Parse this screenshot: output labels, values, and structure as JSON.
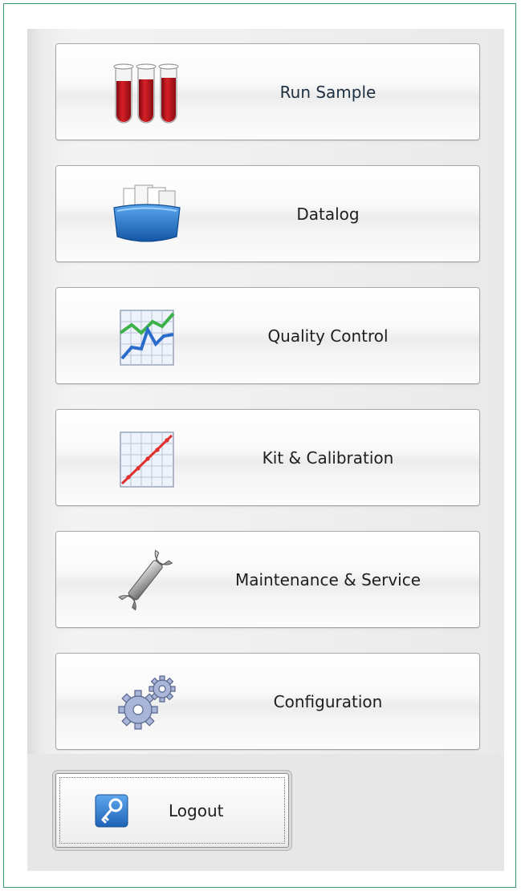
{
  "menu": {
    "items": [
      {
        "label": "Run Sample",
        "icon": "test-tubes-icon"
      },
      {
        "label": "Datalog",
        "icon": "folder-files-icon"
      },
      {
        "label": "Quality Control",
        "icon": "qc-chart-icon"
      },
      {
        "label": "Kit & Calibration",
        "icon": "calibration-chart-icon"
      },
      {
        "label": "Maintenance & Service",
        "icon": "wrench-icon"
      },
      {
        "label": "Configuration",
        "icon": "gears-icon"
      }
    ]
  },
  "logout": {
    "label": "Logout",
    "icon": "key-icon"
  },
  "colors": {
    "frame_border": "#3a9a6a",
    "tube_red": "#c0161e",
    "folder_blue": "#1f6fc4",
    "qc_green": "#3db24a",
    "qc_blue": "#2a6ccc",
    "calibration_red": "#e03030",
    "key_blue": "#2a7bd0"
  }
}
